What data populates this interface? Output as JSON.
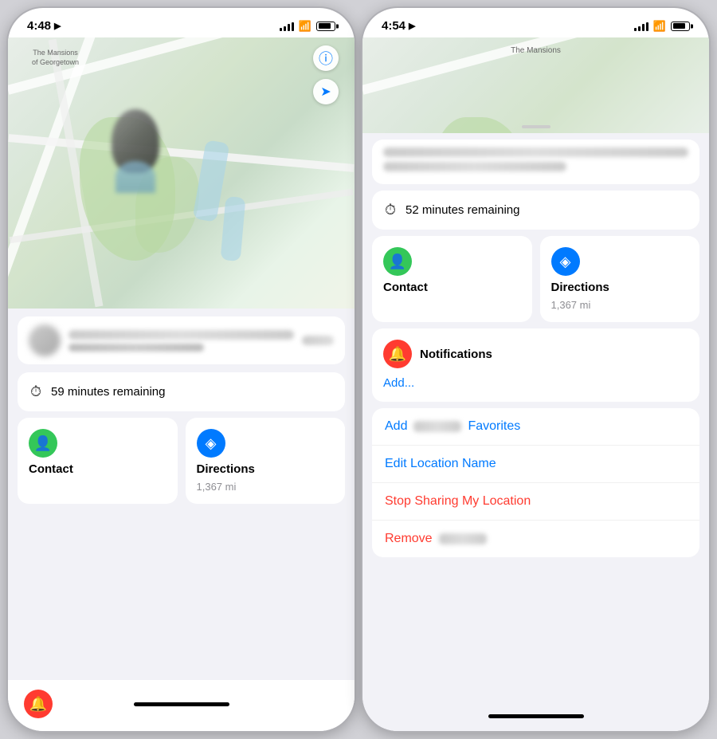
{
  "left_phone": {
    "status_bar": {
      "time": "4:48",
      "location_arrow": "▶"
    },
    "map": {
      "label_line1": "The Mansions",
      "label_line2": "of Georgetown"
    },
    "timer": {
      "text": "59 minutes remaining"
    },
    "contact": {
      "label": "Contact"
    },
    "directions": {
      "label": "Directions",
      "distance": "1,367 mi"
    },
    "info_btn": "ℹ",
    "location_arrow": "➤"
  },
  "right_phone": {
    "status_bar": {
      "time": "4:54",
      "location_arrow": "▶"
    },
    "map": {
      "label": "The Mansions"
    },
    "timer": {
      "text": "52 minutes remaining"
    },
    "contact": {
      "label": "Contact"
    },
    "directions": {
      "label": "Directions",
      "distance": "1,367 mi"
    },
    "notifications": {
      "title": "Notifications",
      "add_link": "Add..."
    },
    "action_list": {
      "add_favorites": "Add",
      "add_favorites_suffix": "Favorites",
      "edit_location": "Edit Location Name",
      "stop_sharing": "Stop Sharing My Location",
      "remove": "Remove"
    }
  },
  "icons": {
    "info": "ⓘ",
    "location_arrow": "◂",
    "timer": "⏱",
    "contact_person": "♟",
    "directions_arrow": "◈",
    "bell": "🔔",
    "battery": "▮"
  }
}
